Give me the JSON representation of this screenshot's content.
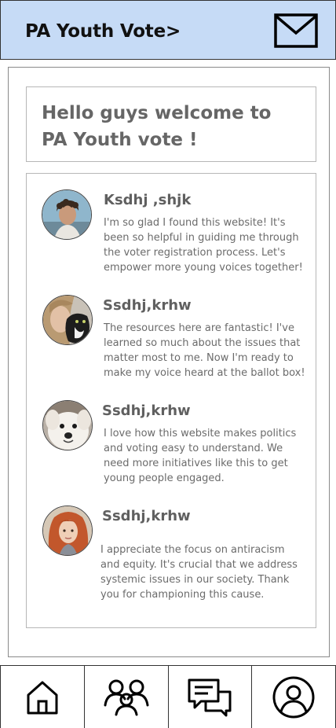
{
  "header": {
    "title": "PA Youth Vote>",
    "mail_icon": "mail-icon"
  },
  "welcome": {
    "line1": "Hello guys welcome to",
    "line2": "PA Youth vote !"
  },
  "posts": [
    {
      "author": "Ksdhj ,shjk",
      "text": "I'm so glad I found this website! It's been so helpful in guiding me through the voter registration process. Let's empower more young voices together!",
      "avatar": "avatar-young-man-curly-hair"
    },
    {
      "author": "Ssdhj,krhw",
      "text": "The resources here are fantastic! I've learned so much about the issues that matter most to me. Now I'm ready to make my voice heard at the ballot box!",
      "avatar": "avatar-girl-with-cat"
    },
    {
      "author": "Ssdhj,krhw",
      "text": "I love how this website makes politics and voting easy to understand. We need more initiatives like this to get young people engaged.",
      "avatar": "avatar-white-dog"
    },
    {
      "author": "Ssdhj,krhw",
      "text": "I appreciate the focus on antiracism and equity. It's crucial that we address systemic issues in our society. Thank you for championing this cause.",
      "avatar": "avatar-red-haired-woman"
    }
  ],
  "tabbar": {
    "items": [
      "home-icon",
      "community-icon",
      "chat-icon",
      "profile-icon"
    ]
  },
  "colors": {
    "header_bg": "#c6dbf6",
    "text_gray": "#666666",
    "border_gray": "#b7b7b7"
  }
}
